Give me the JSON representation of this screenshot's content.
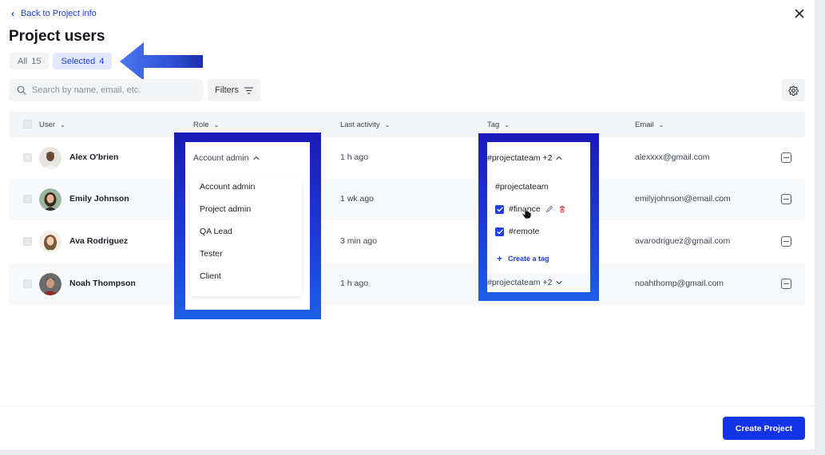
{
  "header": {
    "back_label": "Back to Project info",
    "title": "Project users"
  },
  "tabs": [
    {
      "label": "All",
      "count": "15"
    },
    {
      "label": "Selected",
      "count": "4"
    }
  ],
  "search": {
    "placeholder": "Search by name, email, etc."
  },
  "toolbar": {
    "filters_label": "Filters"
  },
  "columns": {
    "user": "User",
    "role": "Role",
    "last_activity": "Last activity",
    "tag": "Tag",
    "email": "Email"
  },
  "rows": [
    {
      "name": "Alex O'brien",
      "role": "",
      "activity": "1 h ago",
      "tag": "",
      "email": "alexxxx@gmail.com"
    },
    {
      "name": "Emily Johnson",
      "role": "",
      "activity": "1 wk ago",
      "tag": "",
      "email": "emilyjohnson@email.com"
    },
    {
      "name": "Ava Rodriguez",
      "role": "",
      "activity": "3 min ago",
      "tag": "",
      "email": "avarodriguez@gmail.com"
    },
    {
      "name": "Noah Thompson",
      "role": "",
      "activity": "1 h ago",
      "tag": "#projectateam +2",
      "email": "noahthomp@gmail.com"
    }
  ],
  "role_dropdown": {
    "selected": "Account admin",
    "options": [
      "Account admin",
      "Project admin",
      "QA Lead",
      "Tester",
      "Client"
    ]
  },
  "tag_dropdown": {
    "selected": "#projectateam +2",
    "options": [
      {
        "label": "#projectateam",
        "checked": false
      },
      {
        "label": "#finance",
        "checked": true
      },
      {
        "label": "#remote",
        "checked": true
      }
    ],
    "create_label": "Create a tag"
  },
  "footer": {
    "create_label": "Create Project"
  },
  "colors": {
    "accent": "#1E3FE0",
    "highlight": "#1D3AD6",
    "danger": "#E5484D"
  }
}
